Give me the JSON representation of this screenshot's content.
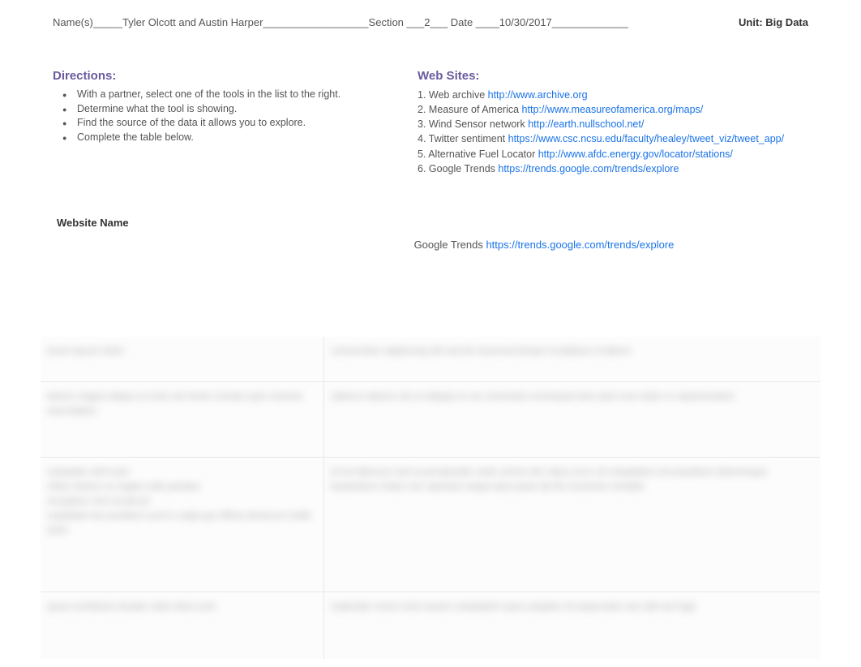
{
  "header": {
    "line": "Name(s)_____Tyler Olcott and Austin Harper__________________Section ___2___ Date ____10/30/2017_____________",
    "unit": "Unit: Big Data"
  },
  "directions": {
    "heading": "Directions:",
    "items": [
      "With a partner, select one of the tools in the list to the right.",
      "Determine what the tool is showing.",
      "Find the source of the data it allows you to explore.",
      "Complete the table below."
    ]
  },
  "websites": {
    "heading": "Web Sites:",
    "items": [
      {
        "num": "1. ",
        "label": "Web archive ",
        "url": "http://www.archive.org"
      },
      {
        "num": "2. ",
        "label": "Measure of America ",
        "url": "http://www.measureofamerica.org/maps/"
      },
      {
        "num": "3. ",
        "label": "Wind Sensor network ",
        "url": "http://earth.nullschool.net/"
      },
      {
        "num": "4. ",
        "label": "Twitter sentiment ",
        "url": "https://www.csc.ncsu.edu/faculty/healey/tweet_viz/tweet_app/"
      },
      {
        "num": "5. ",
        "label": "Alternative Fuel Locator ",
        "url": "http://www.afdc.energy.gov/locator/stations/"
      },
      {
        "num": "6. ",
        "label": "Google Trends ",
        "url": "https://trends.google.com/trends/explore"
      }
    ]
  },
  "table": {
    "col_label": "Website Name",
    "entry_label": "Google Trends ",
    "entry_url": "https://trends.google.com/trends/explore"
  }
}
